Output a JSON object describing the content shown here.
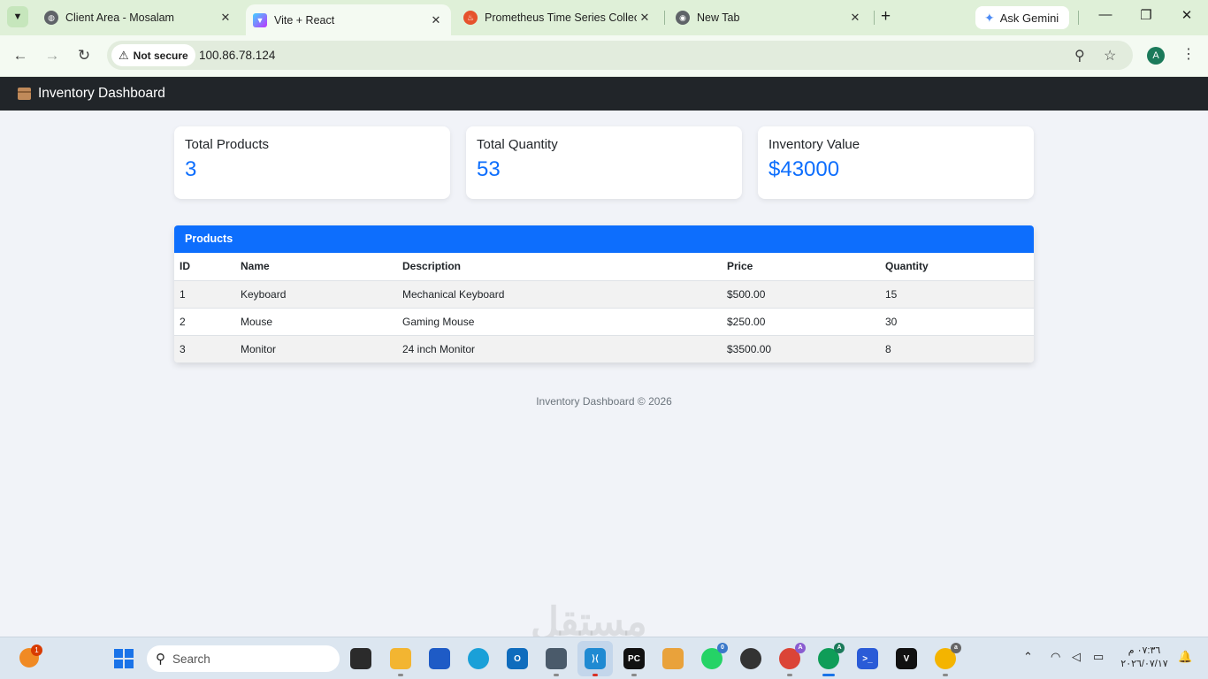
{
  "browser": {
    "tabs": [
      {
        "title": "Client Area - Mosalam",
        "icon": "globe-icon"
      },
      {
        "title": "Vite + React",
        "icon": "vite-icon",
        "active": true
      },
      {
        "title": "Prometheus Time Series Collect",
        "icon": "prometheus-icon"
      },
      {
        "title": "New Tab",
        "icon": "chrome-icon"
      }
    ],
    "new_tab_glyph": "+",
    "ask_gemini": "Ask Gemini",
    "security_label": "Not secure",
    "url": "100.86.78.124",
    "profile_initial": "A",
    "accent_color": "#dff0d8"
  },
  "app": {
    "brand": "Inventory Dashboard",
    "brand_icon": "package-icon",
    "navbar_color": "#212529",
    "primary_color": "#0d6efd"
  },
  "stats": [
    {
      "label": "Total Products",
      "value": "3"
    },
    {
      "label": "Total Quantity",
      "value": "53"
    },
    {
      "label": "Inventory Value",
      "value": "$43000"
    }
  ],
  "products": {
    "title": "Products",
    "columns": [
      "ID",
      "Name",
      "Description",
      "Price",
      "Quantity"
    ],
    "rows": [
      [
        "1",
        "Keyboard",
        "Mechanical Keyboard",
        "$500.00",
        "15"
      ],
      [
        "2",
        "Mouse",
        "Gaming Mouse",
        "$250.00",
        "30"
      ],
      [
        "3",
        "Monitor",
        "24 inch Monitor",
        "$3500.00",
        "8"
      ]
    ]
  },
  "footer": "Inventory Dashboard © 2026",
  "taskbar": {
    "search_placeholder": "Search",
    "weather_badge": "1",
    "whatsapp_badge": "0",
    "chrome_a_badge": "A",
    "chrome_b_badge": "A",
    "chrome_c_badge": "a",
    "clock_time": "٠٧:٣٦ م",
    "clock_date": "٢٠٢٦/٠٧/١٧"
  },
  "watermark": "مستقل"
}
